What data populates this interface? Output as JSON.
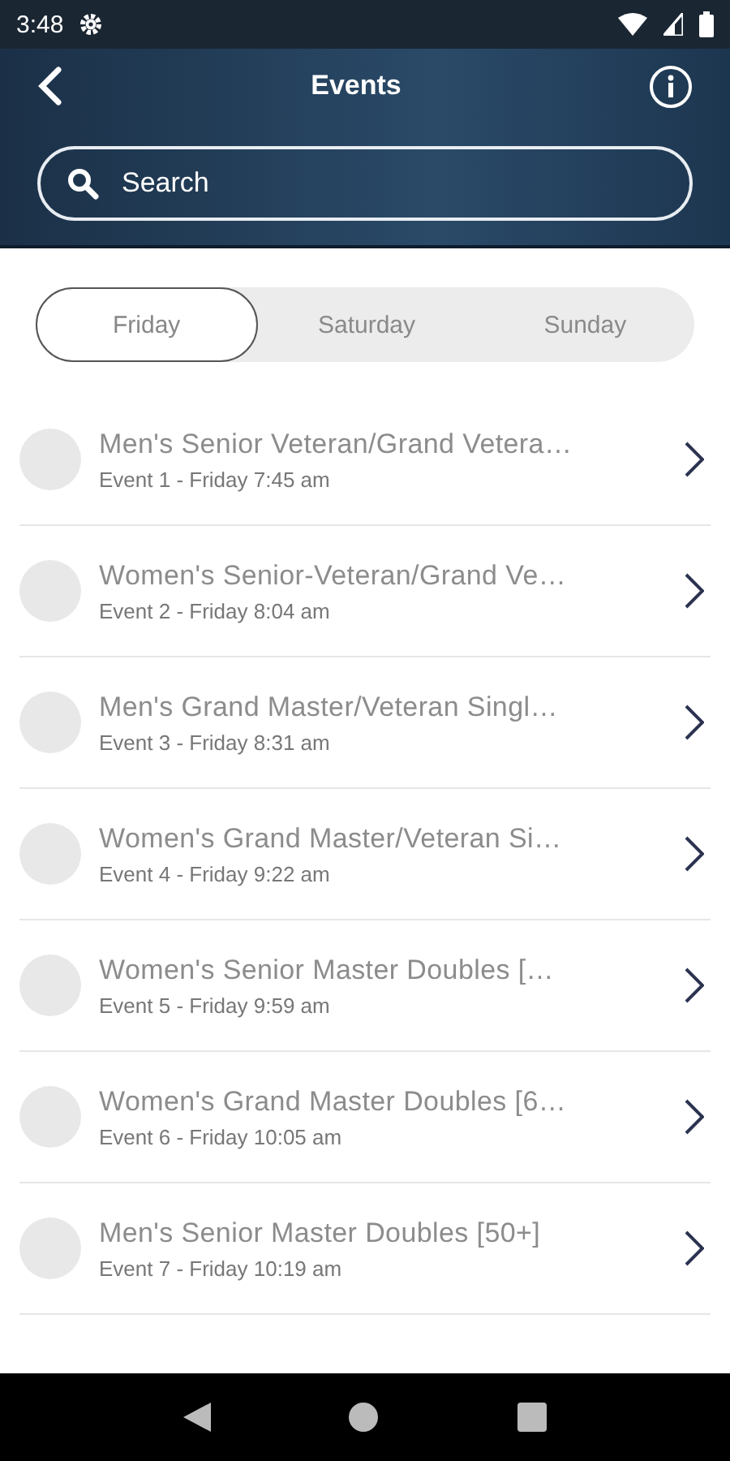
{
  "status_bar": {
    "time": "3:48"
  },
  "header": {
    "title": "Events"
  },
  "search": {
    "placeholder": "Search"
  },
  "day_tabs": [
    {
      "label": "Friday",
      "selected": true
    },
    {
      "label": "Saturday",
      "selected": false
    },
    {
      "label": "Sunday",
      "selected": false
    }
  ],
  "events": [
    {
      "title": "Men's Senior Veteran/Grand Vetera…",
      "subtitle": "Event 1 - Friday 7:45 am"
    },
    {
      "title": "Women's Senior-Veteran/Grand Ve…",
      "subtitle": "Event 2 - Friday 8:04 am"
    },
    {
      "title": "Men's Grand Master/Veteran Singl…",
      "subtitle": "Event 3 - Friday 8:31 am"
    },
    {
      "title": "Women's Grand Master/Veteran Si…",
      "subtitle": "Event 4 - Friday 9:22 am"
    },
    {
      "title": "Women's Senior Master Doubles […",
      "subtitle": "Event 5 - Friday 9:59 am"
    },
    {
      "title": "Women's Grand Master Doubles [6…",
      "subtitle": "Event 6 - Friday 10:05 am"
    },
    {
      "title": "Men's Senior Master Doubles [50+]",
      "subtitle": "Event 7 - Friday 10:19 am"
    }
  ]
}
